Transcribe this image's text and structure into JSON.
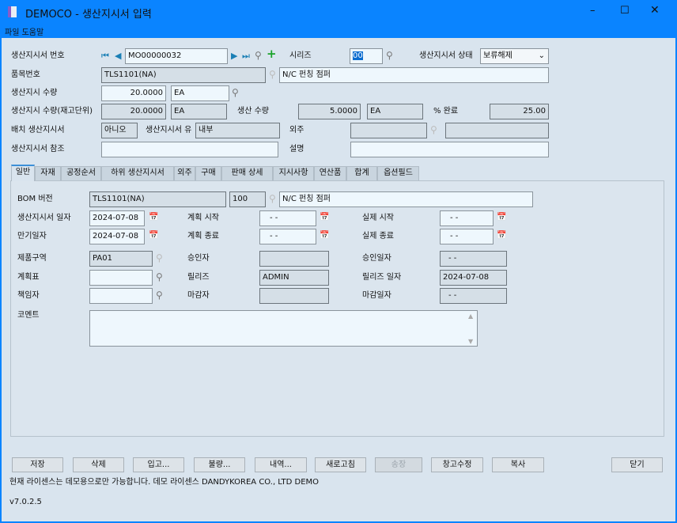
{
  "window": {
    "title": "DEMOCO - 생산지시서 입력",
    "minimize": "–",
    "maximize": "☐",
    "close": "✕"
  },
  "menu": {
    "label": "파일 도움말"
  },
  "header": {
    "order_no_label": "생산지시서 번호",
    "order_no": "MO00000032",
    "series_label": "시리즈",
    "series": "00",
    "status_label": "생산지시서 상태",
    "status": "보류해제",
    "item_label": "품목번호",
    "item_no": "TLS1101(NA)",
    "item_desc": "N/C 펀칭 점퍼",
    "qty_label": "생산지시 수량",
    "qty": "20.0000",
    "qty_unit": "EA",
    "qty_stock_label": "생산지시 수량(재고단위)",
    "qty_stock": "20.0000",
    "qty_stock_unit": "EA",
    "prod_qty_label": "생산 수량",
    "prod_qty": "5.0000",
    "prod_qty_unit": "EA",
    "pct_label": "% 완료",
    "pct": "25.00",
    "batch_label": "배치 생산지시서",
    "batch": "아니오",
    "type_label": "생산지시서 유",
    "type": "내부",
    "outsource_label": "외주",
    "outsource": "",
    "outsource_desc": "",
    "ref_label": "생산지시서 참조",
    "ref": "",
    "desc_label": "설명",
    "desc": ""
  },
  "tabs": [
    "일반",
    "자재",
    "공정순서",
    "하위 생산지시서",
    "외주",
    "구매",
    "판매 상세",
    "지시사항",
    "연산품",
    "합계",
    "옵션필드"
  ],
  "general": {
    "bom_label": "BOM 버전",
    "bom": "TLS1101(NA)",
    "bom_rev": "100",
    "bom_desc": "N/C 펀칭 점퍼",
    "order_date_label": "생산지시서 일자",
    "order_date": "2024-07-08",
    "plan_start_label": "계획 시작",
    "plan_start": "- -",
    "actual_start_label": "실제 시작",
    "actual_start": "- -",
    "due_label": "만기일자",
    "due": "2024-07-08",
    "plan_end_label": "계획 종료",
    "plan_end": "- -",
    "actual_end_label": "실제 종료",
    "actual_end": "- -",
    "zone_label": "제품구역",
    "zone": "PA01",
    "approver_label": "승인자",
    "approver": "",
    "approve_date_label": "승인일자",
    "approve_date": "- -",
    "plan_label": "계획표",
    "plan": "",
    "release_label": "릴리즈",
    "release": "ADMIN",
    "release_date_label": "릴리즈 일자",
    "release_date": "2024-07-08",
    "owner_label": "책임자",
    "owner": "",
    "closer_label": "마감자",
    "closer": "",
    "close_date_label": "마감일자",
    "close_date": "- -",
    "comment_label": "코멘트",
    "comment": ""
  },
  "buttons": [
    "저장",
    "삭제",
    "입고...",
    "불량...",
    "내역...",
    "새로고침",
    "송장",
    "창고수정",
    "복사"
  ],
  "close_button": "닫기",
  "license": "현재 라이센스는 데모용으로만 가능합니다. 데모 라이센스 DANDYKOREA CO., LTD DEMO",
  "version": "v7.0.2.5"
}
